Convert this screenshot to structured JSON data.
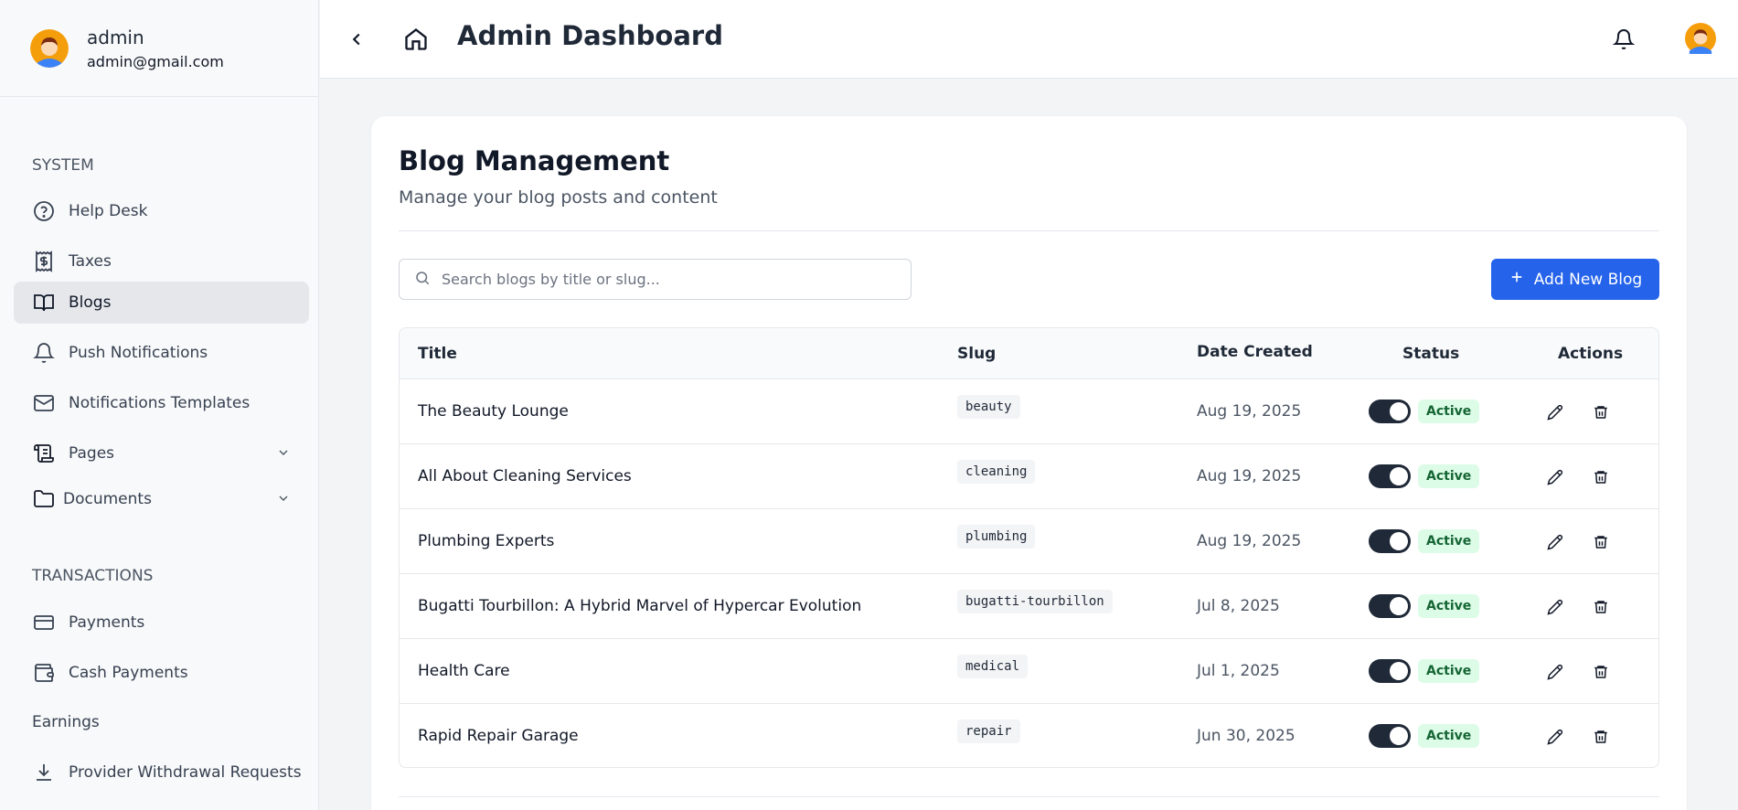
{
  "user": {
    "name": "admin",
    "email": "admin@gmail.com"
  },
  "header": {
    "title": "Admin Dashboard"
  },
  "sidebar": {
    "system_title": "SYSTEM",
    "system_items": [
      {
        "label": "Help Desk",
        "icon": "help-circle-icon"
      },
      {
        "label": "Taxes",
        "icon": "receipt-dollar-icon"
      },
      {
        "label": "Blogs",
        "icon": "book-open-icon",
        "active": true
      },
      {
        "label": "Push Notifications",
        "icon": "bell-icon"
      },
      {
        "label": "Notifications Templates",
        "icon": "mail-icon"
      },
      {
        "label": "Pages",
        "icon": "scroll-icon",
        "expandable": true
      },
      {
        "label": "Documents",
        "icon": "folder-icon",
        "expandable": true
      }
    ],
    "transactions_title": "TRANSACTIONS",
    "transaction_items": [
      {
        "label": "Payments",
        "icon": "credit-card-icon"
      },
      {
        "label": "Cash Payments",
        "icon": "wallet-icon"
      }
    ],
    "earnings_label": "Earnings",
    "withdrawal_label": "Provider Withdrawal Requests"
  },
  "page": {
    "title": "Blog Management",
    "subtitle": "Manage your blog posts and content",
    "search_placeholder": "Search blogs by title or slug...",
    "add_button": "Add New Blog"
  },
  "table": {
    "columns": [
      "Title",
      "Slug",
      "Date Created",
      "Status",
      "Actions"
    ],
    "rows": [
      {
        "title": "The Beauty Lounge",
        "slug": "beauty",
        "date": "Aug 19, 2025",
        "status": "Active",
        "enabled": true
      },
      {
        "title": "All About Cleaning Services",
        "slug": "cleaning",
        "date": "Aug 19, 2025",
        "status": "Active",
        "enabled": true
      },
      {
        "title": "Plumbing Experts",
        "slug": "plumbing",
        "date": "Aug 19, 2025",
        "status": "Active",
        "enabled": true
      },
      {
        "title": "Bugatti Tourbillon: A Hybrid Marvel of Hypercar Evolution",
        "slug": "bugatti-tourbillon",
        "date": "Jul 8, 2025",
        "status": "Active",
        "enabled": true
      },
      {
        "title": "Health Care",
        "slug": "medical",
        "date": "Jul 1, 2025",
        "status": "Active",
        "enabled": true
      },
      {
        "title": "Rapid Repair Garage",
        "slug": "repair",
        "date": "Jun 30, 2025",
        "status": "Active",
        "enabled": true
      }
    ]
  },
  "colors": {
    "primary": "#2563eb",
    "active_badge_bg": "#dcfce7",
    "active_badge_text": "#166534",
    "toggle_on": "#1f2937"
  }
}
